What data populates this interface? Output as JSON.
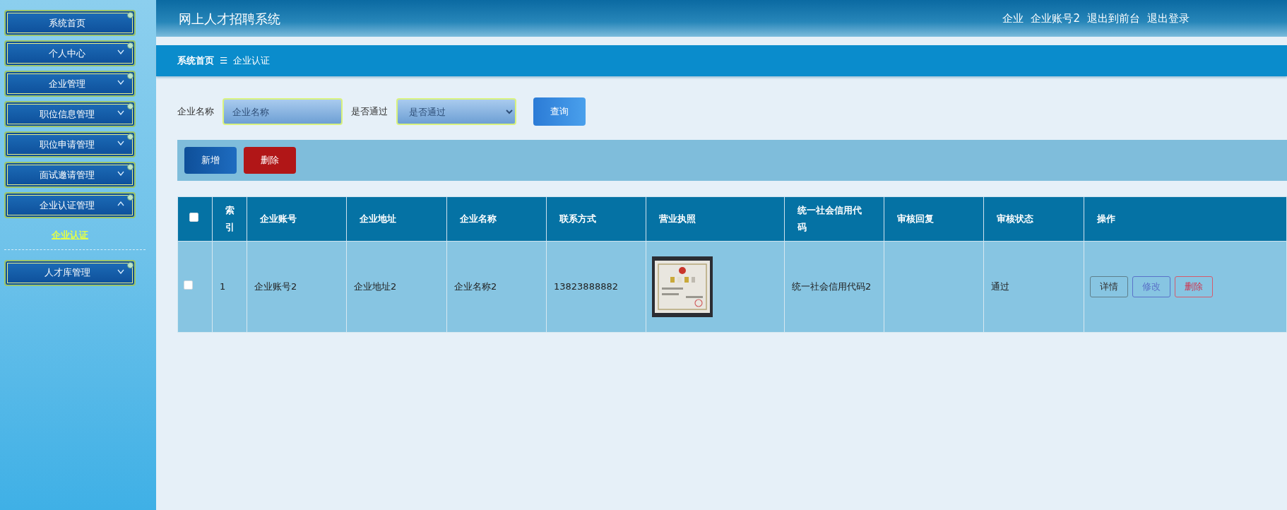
{
  "header": {
    "title": "网上人才招聘系统",
    "user_role": "企业",
    "user_name": "企业账号2",
    "links": [
      "退出到前台",
      "退出登录"
    ]
  },
  "sidebar": {
    "items": [
      {
        "label": "系统首页",
        "kind": "link"
      },
      {
        "label": "个人中心",
        "kind": "group",
        "expanded": false
      },
      {
        "label": "企业管理",
        "kind": "group",
        "expanded": false
      },
      {
        "label": "职位信息管理",
        "kind": "group",
        "expanded": false
      },
      {
        "label": "职位申请管理",
        "kind": "group",
        "expanded": false
      },
      {
        "label": "面试邀请管理",
        "kind": "group",
        "expanded": false
      },
      {
        "label": "企业认证管理",
        "kind": "group",
        "expanded": true,
        "children": [
          {
            "label": "企业认证",
            "selected": true
          }
        ]
      },
      {
        "label": "人才库管理",
        "kind": "group",
        "expanded": false
      }
    ]
  },
  "breadcrumb": {
    "items": [
      "系统首页",
      "企业认证"
    ],
    "separator": "☰"
  },
  "search": {
    "fields": [
      {
        "label": "企业名称",
        "placeholder": "企业名称",
        "kind": "input"
      },
      {
        "label": "是否通过",
        "placeholder": "是否通过",
        "kind": "select"
      }
    ],
    "button": "查询"
  },
  "toolbar": {
    "buttons": [
      {
        "label": "新增",
        "kind": "primary"
      },
      {
        "label": "删除",
        "kind": "danger"
      }
    ]
  },
  "table": {
    "select_all": {
      "checked": false
    },
    "columns": [
      "索引",
      "企业账号",
      "企业地址",
      "企业名称",
      "联系方式",
      "营业执照",
      "统一社会信用代码",
      "审核回复",
      "审核状态",
      "操作"
    ],
    "rows": [
      {
        "checked": false,
        "index": "1",
        "account": "企业账号2",
        "address": "企业地址2",
        "name": "企业名称2",
        "phone": "13823888882",
        "credit_code": "统一社会信用代码2",
        "status": "通过",
        "actions": [
          {
            "label": "详情",
            "kind": "detail"
          },
          {
            "label": "修改",
            "kind": "edit"
          },
          {
            "label": "删除",
            "kind": "delete"
          }
        ]
      }
    ]
  }
}
